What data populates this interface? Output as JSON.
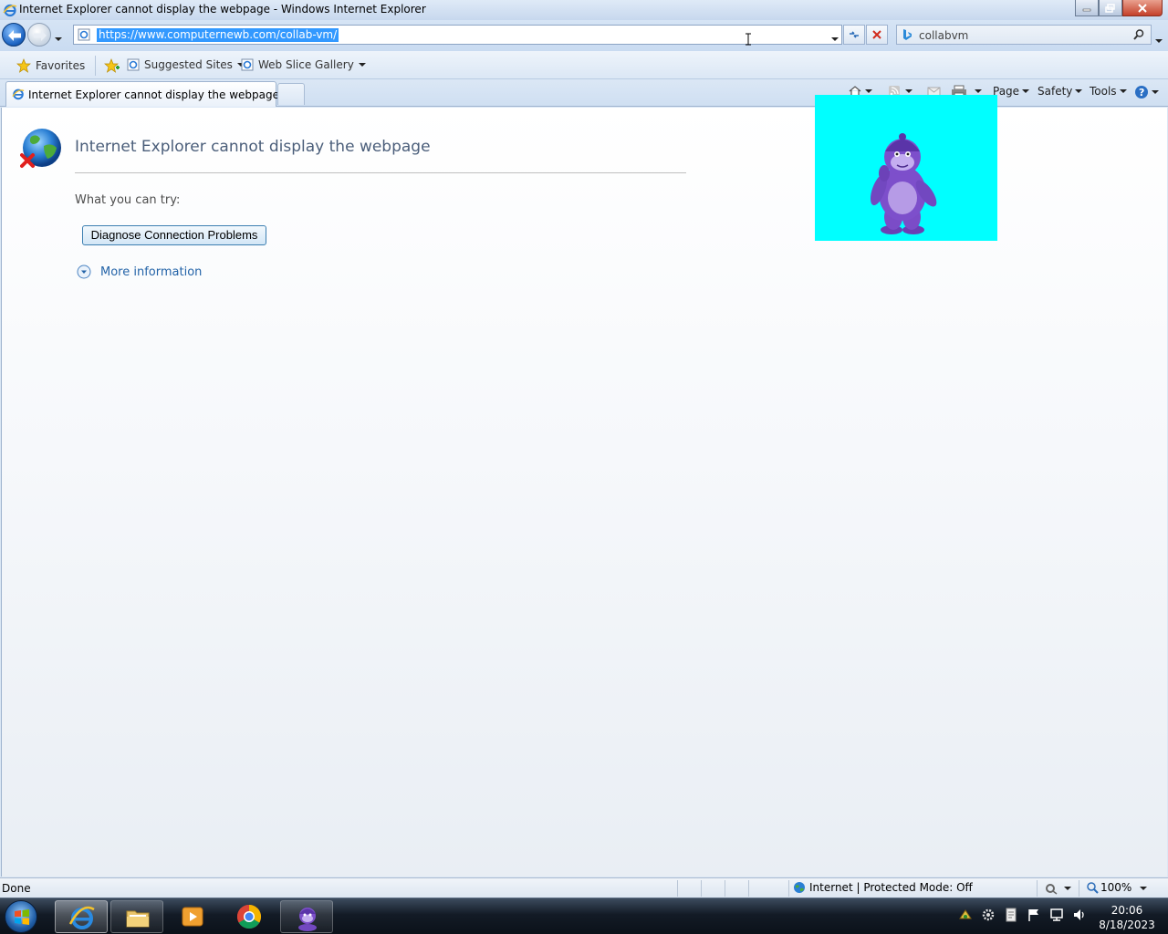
{
  "window": {
    "title": "Internet Explorer cannot display the webpage - Windows Internet Explorer"
  },
  "address_bar": {
    "url": "https://www.computernewb.com/collab-vm/"
  },
  "search": {
    "query": "collabvm"
  },
  "favorites_bar": {
    "favorites_label": "Favorites",
    "items": [
      {
        "label": "Suggested Sites"
      },
      {
        "label": "Web Slice Gallery"
      }
    ]
  },
  "tabs": [
    {
      "title": "Internet Explorer cannot display the webpage"
    }
  ],
  "command_bar": {
    "page_label": "Page",
    "safety_label": "Safety",
    "tools_label": "Tools"
  },
  "error_page": {
    "heading": "Internet Explorer cannot display the webpage",
    "try_label": "What you can try:",
    "diagnose_button": "Diagnose Connection Problems",
    "more_info_link": "More information"
  },
  "status_bar": {
    "status": "Done",
    "zone": "Internet | Protected Mode: Off",
    "zoom": "100%"
  },
  "taskbar": {
    "time": "20:06",
    "date": "8/18/2023"
  },
  "colors": {
    "selection": "#3399ff",
    "overlay_background": "#00ffff",
    "link": "#2464a8"
  }
}
